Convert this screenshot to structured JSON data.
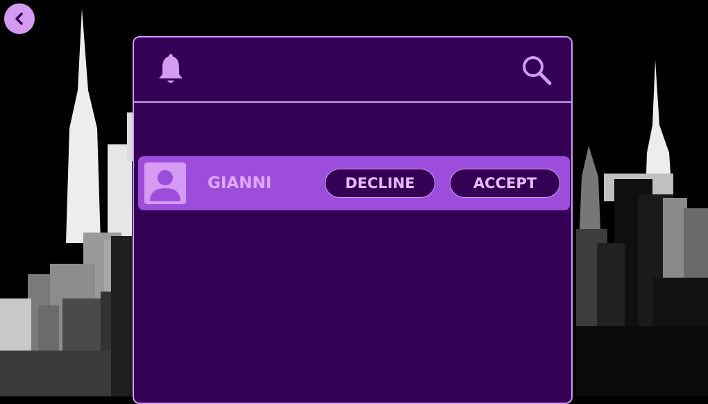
{
  "header": {
    "notifications_icon": "bell-icon",
    "search_icon": "search-icon"
  },
  "navigation": {
    "back_icon": "chevron-left-icon"
  },
  "friend_requests": [
    {
      "name": "GIANNI",
      "avatar_icon": "person-icon",
      "decline_label": "DECLINE",
      "accept_label": "ACCEPT"
    }
  ],
  "colors": {
    "panel_bg": "#330055",
    "accent": "#d59bf3",
    "row_bg": "#9c4ddb",
    "background": "#000000"
  }
}
